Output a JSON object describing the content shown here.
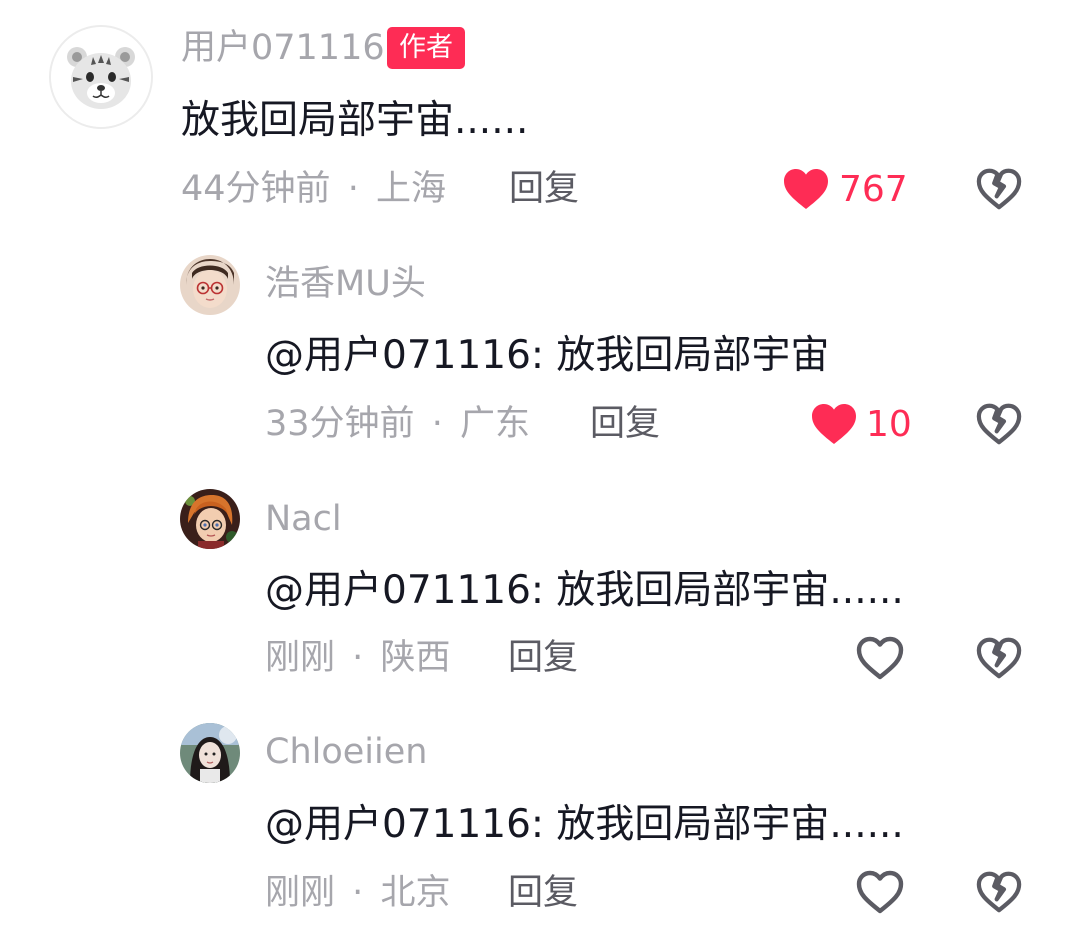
{
  "main_comment": {
    "username": "用户071116",
    "badge": "作者",
    "text": "放我回局部宇宙......",
    "time": "44分钟前",
    "separator": "·",
    "location": "上海",
    "reply_label": "回复",
    "like_count": "767",
    "liked": true,
    "avatar_icon": "tiger-avatar"
  },
  "replies": [
    {
      "username": "浩香MU头",
      "text": "@用户071116: 放我回局部宇宙",
      "time": "33分钟前",
      "separator": "·",
      "location": "广东",
      "reply_label": "回复",
      "like_count": "10",
      "liked": true
    },
    {
      "username": "Nacl",
      "text": "@用户071116: 放我回局部宇宙......",
      "time": "刚刚",
      "separator": "·",
      "location": "陕西",
      "reply_label": "回复",
      "like_count": "",
      "liked": false
    },
    {
      "username": "Chloeiien",
      "text": "@用户071116: 放我回局部宇宙......",
      "time": "刚刚",
      "separator": "·",
      "location": "北京",
      "reply_label": "回复",
      "like_count": "",
      "liked": false
    }
  ],
  "colors": {
    "accent": "#fe2c55",
    "muted_text": "#a6a6ac",
    "body_text": "#161823",
    "icon_gray": "#5b5b63"
  }
}
